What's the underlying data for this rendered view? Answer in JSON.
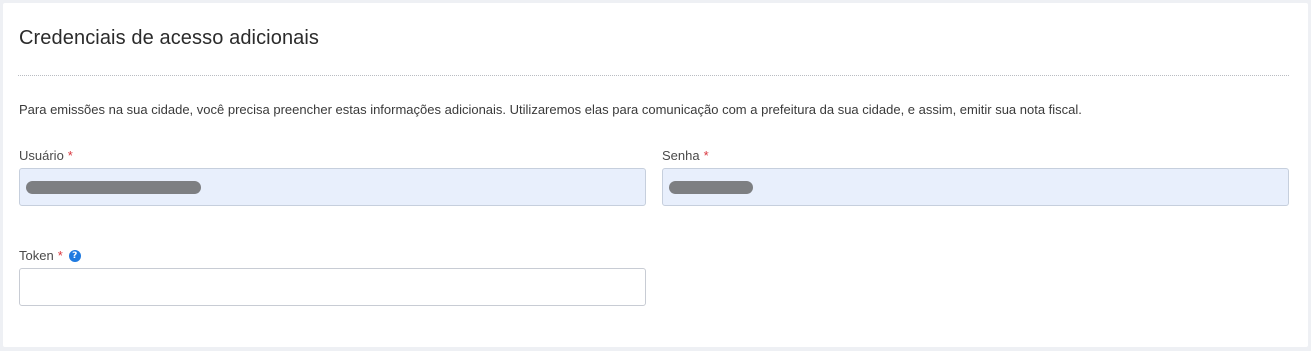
{
  "section": {
    "title": "Credenciais de acesso adicionais",
    "description": "Para emissões na sua cidade, você precisa preencher estas informações adicionais. Utilizaremos elas para comunicação com a prefeitura da sua cidade, e assim, emitir sua nota fiscal."
  },
  "fields": {
    "usuario": {
      "label": "Usuário",
      "required_mark": "*",
      "value_masked": true
    },
    "senha": {
      "label": "Senha",
      "required_mark": "*",
      "value_masked": true
    },
    "token": {
      "label": "Token",
      "required_mark": "*",
      "help_icon": "question-circle-icon",
      "help_glyph": "?",
      "value": ""
    }
  },
  "colors": {
    "required": "#d9363e",
    "help_icon": "#1f7ae0",
    "filled_input_bg": "#e8effc"
  }
}
